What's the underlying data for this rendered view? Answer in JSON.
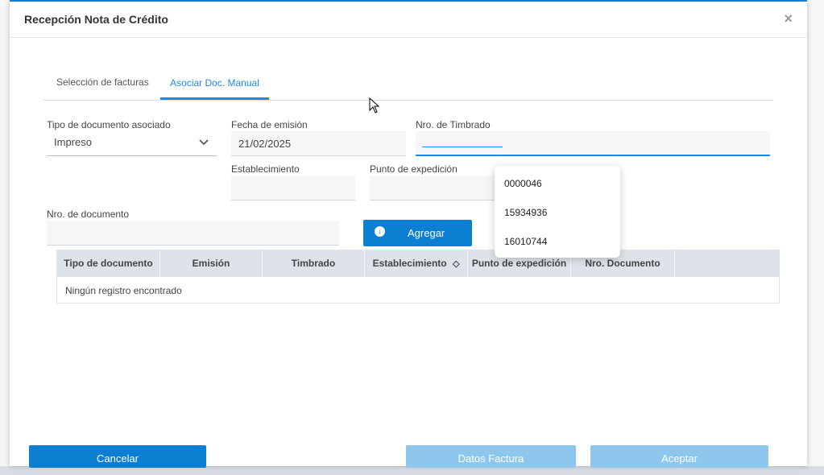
{
  "modal": {
    "title": "Recepción Nota de Crédito",
    "close_icon": "close-icon"
  },
  "tabs": [
    {
      "label": "Selección de facturas",
      "active": false
    },
    {
      "label": "Asociar Doc. Manual",
      "active": true
    }
  ],
  "form": {
    "tipo_label": "Tipo de documento asociado",
    "tipo_value": "Impreso",
    "fecha_label": "Fecha de emisión",
    "fecha_value": "21/02/2025",
    "timbrado_label": "Nro. de Timbrado",
    "timbrado_value": "",
    "establecimiento_label": "Establecimiento",
    "establecimiento_value": "",
    "punto_label": "Punto de expedición",
    "punto_value": "",
    "nro_doc_label": "Nro. de documento",
    "nro_doc_value": "",
    "agregar_label": "Agregar"
  },
  "suggestions": [
    "0000046",
    "15934936",
    "16010744"
  ],
  "table": {
    "columns": [
      "Tipo de documento",
      "Emisión",
      "Timbrado",
      "Establecimiento",
      "Punto de expedición",
      "Nro. Documento"
    ],
    "empty_text": "Ningún registro encontrado"
  },
  "footer": {
    "cancel_label": "Cancelar",
    "datos_label": "Datos Factura",
    "aceptar_label": "Aceptar"
  },
  "colors": {
    "accent": "#0d7fd1",
    "disabled_button": "#8ec7ee",
    "table_header": "#dde3e8"
  }
}
